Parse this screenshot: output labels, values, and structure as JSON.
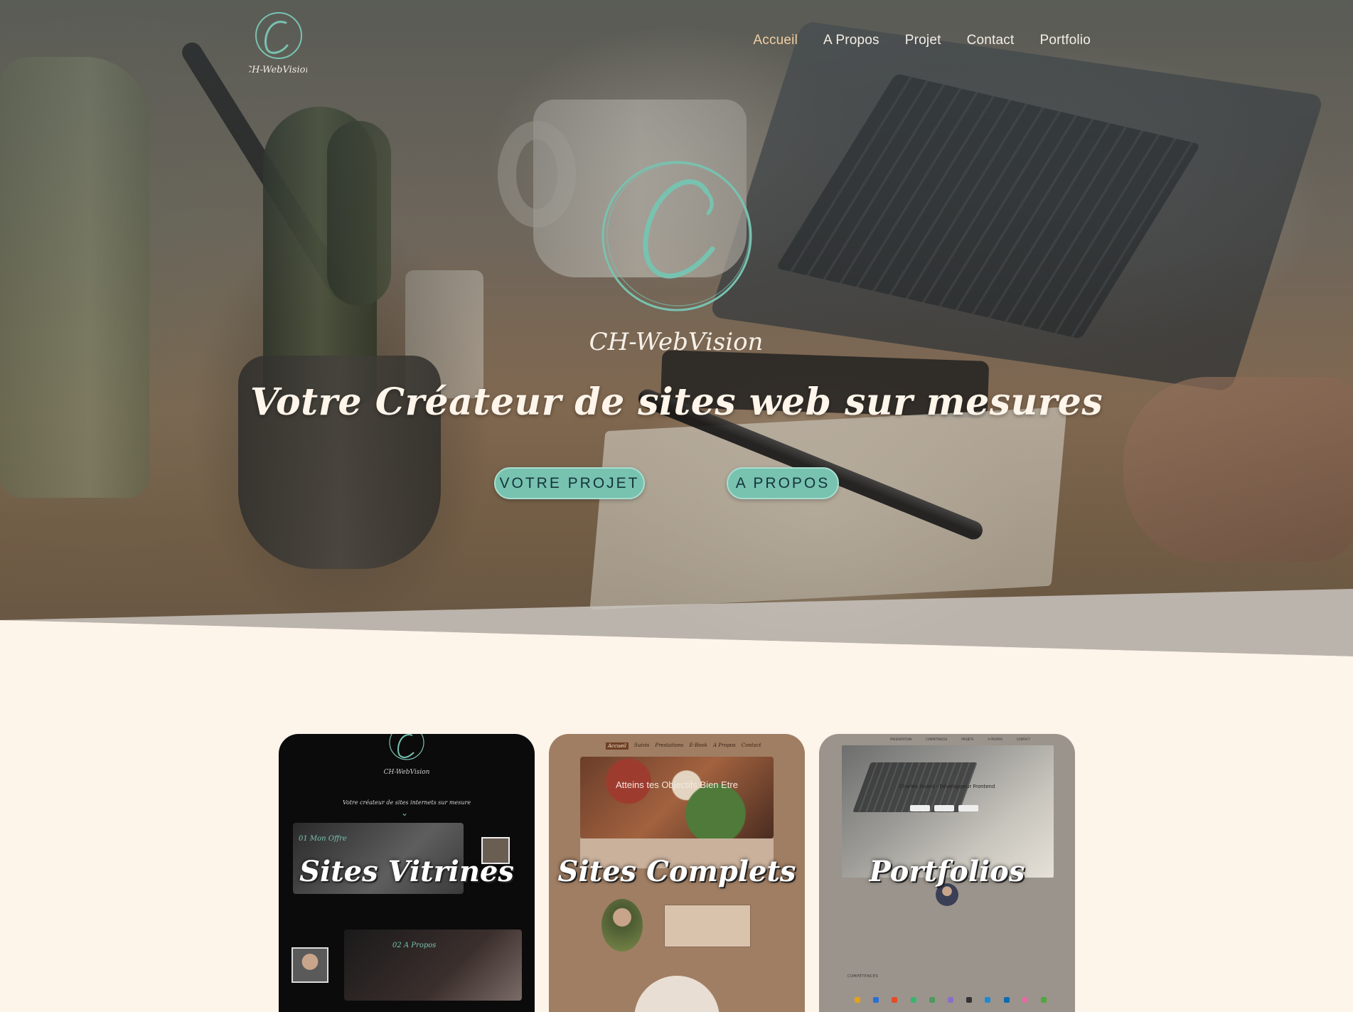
{
  "brand": {
    "name": "CH-WebVision",
    "accent": "#78c2b0",
    "nav_active_color": "#f2cfa3",
    "background": "#fdf4ea"
  },
  "nav": {
    "items": [
      {
        "label": "Accueil",
        "active": true
      },
      {
        "label": "A Propos",
        "active": false
      },
      {
        "label": "Projet",
        "active": false
      },
      {
        "label": "Contact",
        "active": false
      },
      {
        "label": "Portfolio",
        "active": false
      }
    ]
  },
  "hero": {
    "logo_text": "CH-WebVision",
    "title": "Votre Créateur de sites web sur mesures",
    "buttons": {
      "projet": "VOTRE PROJET",
      "apropos": "A PROPOS"
    }
  },
  "cards": [
    {
      "label": "Sites Vitrines",
      "preview": {
        "logo_text": "CH-WebVision",
        "tagline": "Votre créateur de sites internets sur mesure",
        "panel1_title": "01 Mon Offre",
        "panel2_title": "02 A Propos"
      }
    },
    {
      "label": "Sites Complets",
      "preview": {
        "nav": [
          "Accueil",
          "Suivis",
          "Prestations",
          "E-Book",
          "A Propos",
          "Contact"
        ],
        "hero_text": "Atteins tes Objectifs Bien Etre"
      }
    },
    {
      "label": "Portfolios",
      "preview": {
        "nav": [
          "PRESENTATION",
          "COMPETENCES",
          "PROJETS",
          "A PROPOS",
          "CONTACT"
        ],
        "hero_text": "Charles Huard - Développeur Frontend",
        "section": "COMPÉTENCES"
      }
    }
  ]
}
